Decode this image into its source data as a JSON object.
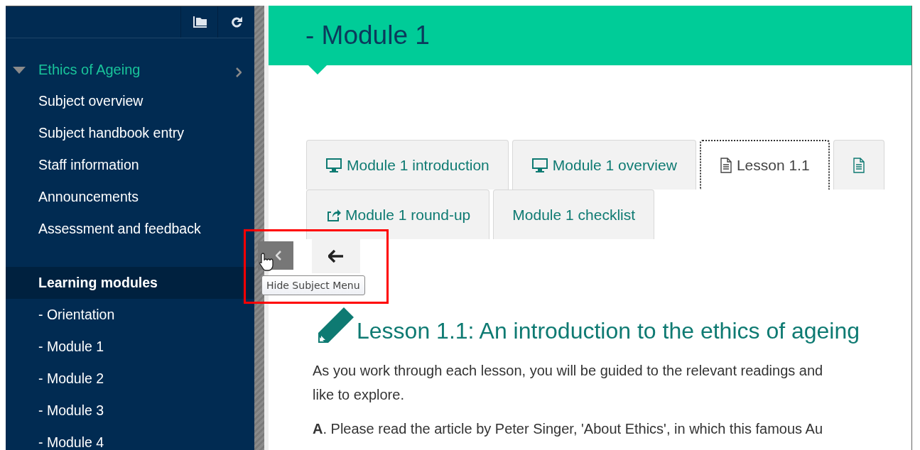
{
  "sidebar": {
    "subject": {
      "title": "Ethics of Ageing",
      "expanded": true
    },
    "items": [
      {
        "label": "Subject overview",
        "selected": false
      },
      {
        "label": "Subject handbook entry",
        "selected": false
      },
      {
        "label": "Staff information",
        "selected": false
      },
      {
        "label": "Announcements",
        "selected": false
      },
      {
        "label": "Assessment and feedback",
        "selected": false
      }
    ],
    "section_items": [
      {
        "label": "Learning modules",
        "selected": true
      },
      {
        "label": "- Orientation",
        "selected": false
      },
      {
        "label": "- Module 1",
        "selected": false
      },
      {
        "label": "- Module 2",
        "selected": false
      },
      {
        "label": "- Module 3",
        "selected": false
      },
      {
        "label": "- Module 4",
        "selected": false
      }
    ]
  },
  "collapse_button": {
    "tooltip": "Hide Subject Menu"
  },
  "page": {
    "title": "- Module 1",
    "tab_rows": [
      [
        {
          "label": "Module 1 introduction",
          "kind": "monitor",
          "selected": false
        },
        {
          "label": "Module 1 overview",
          "kind": "monitor",
          "selected": false
        },
        {
          "label": "Lesson 1.1",
          "kind": "document",
          "selected": true
        },
        {
          "kind": "document",
          "selected": false
        }
      ],
      [
        {
          "label": "Module 1 round-up",
          "kind": "share",
          "selected": false
        },
        {
          "label": "Module 1 checklist",
          "selected": false
        }
      ]
    ],
    "lesson": {
      "title": "Lesson 1.1: An introduction to the ethics of ageing",
      "paragraphs": [
        [
          "As you work through each lesson, you will be guided to the relevant readings and",
          "like to explore."
        ],
        [
          "**A**. Please read the article by Peter Singer, 'About Ethics', in which this famous Au"
        ]
      ]
    }
  }
}
